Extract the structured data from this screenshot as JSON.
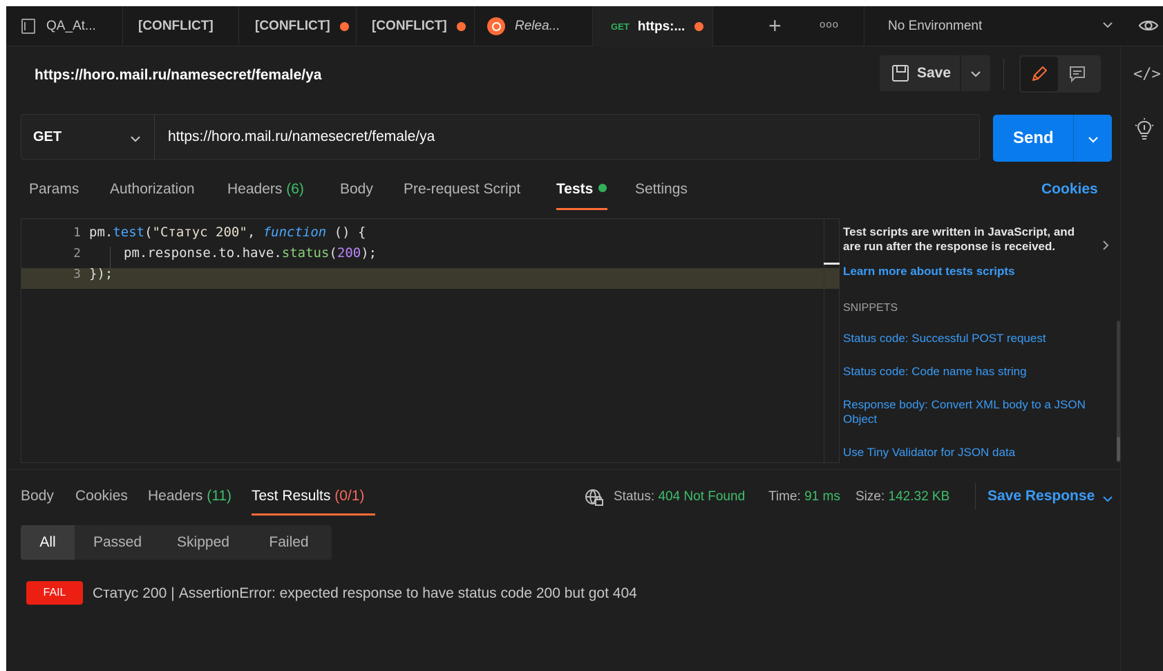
{
  "tabs": [
    {
      "label": "QA_At...",
      "dirty": false
    },
    {
      "label": "[CONFLICT]",
      "dirty": false
    },
    {
      "label": "[CONFLICT]",
      "dirty": true
    },
    {
      "label": "[CONFLICT]",
      "dirty": true
    },
    {
      "label": "Relea...",
      "dirty": false
    },
    {
      "method": "GET",
      "label": "https:...",
      "dirty": true,
      "active": true
    }
  ],
  "environment": {
    "label": "No Environment"
  },
  "request": {
    "title": "https://horo.mail.ru/namesecret/female/ya",
    "method": "GET",
    "url": "https://horo.mail.ru/namesecret/female/ya",
    "save_label": "Save",
    "send_label": "Send"
  },
  "request_tabs": {
    "params": "Params",
    "authorization": "Authorization",
    "headers": "Headers",
    "headers_count": "(6)",
    "body": "Body",
    "prerequest": "Pre-request Script",
    "tests": "Tests",
    "settings": "Settings",
    "cookies": "Cookies",
    "active": "Tests"
  },
  "editor": {
    "line_numbers": [
      "1",
      "2",
      "3"
    ],
    "line1": {
      "obj": "pm.",
      "fn": "test",
      "open": "(",
      "str": "\"Статус 200\"",
      "comma": ", ",
      "kw": "function",
      "rest": " () {"
    },
    "line2": {
      "obj": "pm.response.to.have.",
      "fn": "status",
      "open": "(",
      "num": "200",
      "rest": ");"
    },
    "line3": {
      "text": "});"
    }
  },
  "snippets": {
    "info": "Test scripts are written in JavaScript, and are run after the response is received.",
    "learn_more": "Learn more about tests scripts",
    "heading": "SNIPPETS",
    "items": [
      "Status code: Successful POST request",
      "Status code: Code name has string",
      "Response body: Convert XML body to a JSON Object",
      "Use Tiny Validator for JSON data"
    ]
  },
  "response": {
    "tabs": {
      "body": "Body",
      "cookies": "Cookies",
      "headers": "Headers",
      "headers_count": "(11)",
      "test_results": "Test Results",
      "test_results_count": "(0/1)",
      "active": "Test Results"
    },
    "status_label": "Status:",
    "status_value": "404 Not Found",
    "time_label": "Time:",
    "time_value": "91 ms",
    "size_label": "Size:",
    "size_value": "142.32 KB",
    "save_response": "Save Response",
    "filters": [
      "All",
      "Passed",
      "Skipped",
      "Failed"
    ],
    "active_filter": "All",
    "result": {
      "badge": "FAIL",
      "name": "Статус 200",
      "separator": "|",
      "message": "AssertionError: expected response to have status code 200 but got 404"
    }
  },
  "colors": {
    "accent": "#ff6c37",
    "primary": "#097bed",
    "link": "#3a9bf7",
    "success": "#3fbf6b",
    "fail": "#eb2013"
  }
}
